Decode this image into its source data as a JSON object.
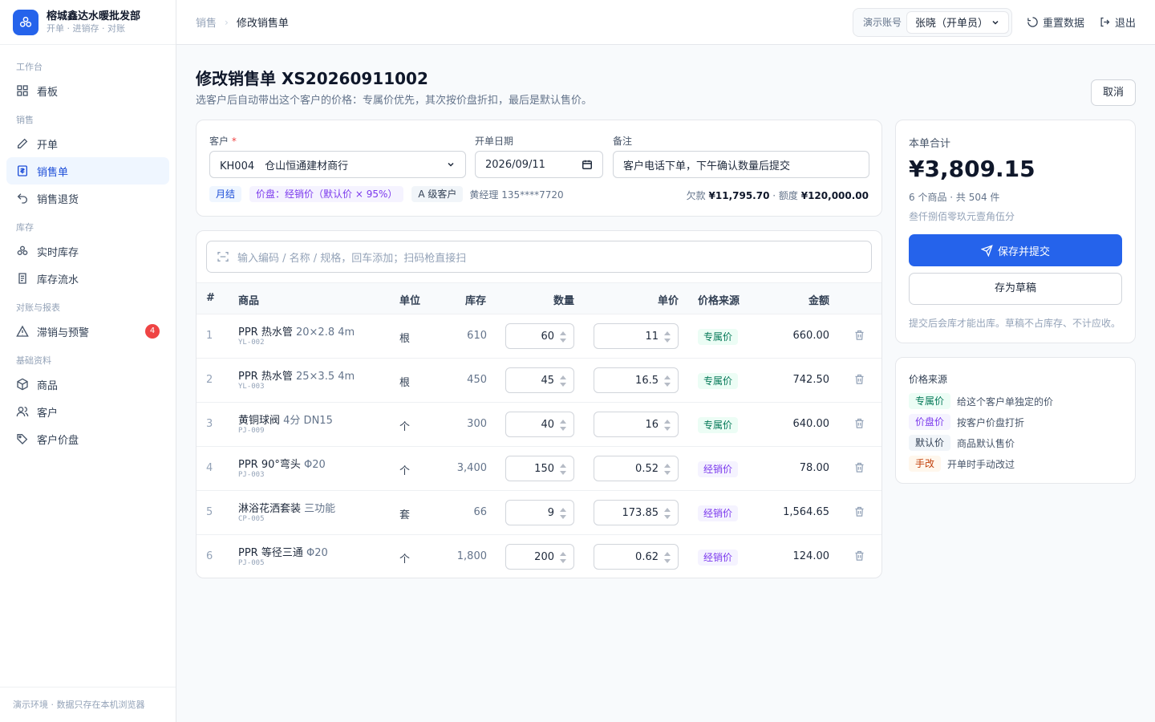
{
  "brand": {
    "name": "榕城鑫达水暖批发部",
    "sub": "开单 · 进销存 · 对账"
  },
  "nav": {
    "groups": [
      {
        "label": "工作台",
        "items": [
          {
            "label": "看板",
            "icon": "dashboard-icon"
          }
        ]
      },
      {
        "label": "销售",
        "items": [
          {
            "label": "开单",
            "icon": "edit-icon"
          },
          {
            "label": "销售单",
            "icon": "receipt-icon",
            "active": true
          },
          {
            "label": "销售退货",
            "icon": "undo-icon"
          }
        ]
      },
      {
        "label": "库存",
        "items": [
          {
            "label": "实时库存",
            "icon": "boxes-icon"
          },
          {
            "label": "库存流水",
            "icon": "scroll-icon"
          }
        ]
      },
      {
        "label": "对账与报表",
        "items": [
          {
            "label": "滞销与预警",
            "icon": "warning-icon",
            "badge": "4"
          }
        ]
      },
      {
        "label": "基础资料",
        "items": [
          {
            "label": "商品",
            "icon": "package-icon"
          },
          {
            "label": "客户",
            "icon": "users-icon"
          },
          {
            "label": "客户价盘",
            "icon": "tags-icon"
          }
        ]
      }
    ],
    "footer": "演示环境 · 数据只存在本机浏览器"
  },
  "topbar": {
    "crumb_parent": "销售",
    "crumb_current": "修改销售单",
    "account_label": "演示账号",
    "account_value": "张晓（开单员）",
    "reset_label": "重置数据",
    "logout_label": "退出"
  },
  "page": {
    "title": "修改销售单 XS20260911002",
    "subtitle": "选客户后自动带出这个客户的价格：专属价优先，其次按价盘折扣，最后是默认售价。",
    "cancel_label": "取消"
  },
  "form": {
    "customer_label": "客户",
    "customer_required": "*",
    "customer_value": "KH004　仓山恒通建材商行",
    "date_label": "开单日期",
    "date_value": "2026/09/11",
    "note_label": "备注",
    "note_value": "客户电话下单，下午确认数量后提交",
    "chip_billing": "月结",
    "chip_pricing": "价盘：经销价（默认价 × 95%）",
    "chip_level": "A 级客户",
    "manager": "黄经理 135****7720",
    "debt_prefix": "欠款",
    "debt_value": "¥11,795.70",
    "credit_prefix": "· 额度",
    "credit_value": "¥120,000.00"
  },
  "search": {
    "placeholder": "输入编码 / 名称 / 规格，回车添加；扫码枪直接扫"
  },
  "table": {
    "headers": {
      "idx": "#",
      "product": "商品",
      "unit": "单位",
      "stock": "库存",
      "qty": "数量",
      "price": "单价",
      "source": "价格来源",
      "amount": "金额"
    },
    "rows": [
      {
        "idx": "1",
        "name": "PPR 热水管",
        "spec": "20×2.8 4m",
        "code": "YL-002",
        "unit": "根",
        "stock": "610",
        "qty": "60",
        "price": "11",
        "source": "专属价",
        "source_type": "exclusive",
        "amount": "660.00"
      },
      {
        "idx": "2",
        "name": "PPR 热水管",
        "spec": "25×3.5 4m",
        "code": "YL-003",
        "unit": "根",
        "stock": "450",
        "qty": "45",
        "price": "16.5",
        "source": "专属价",
        "source_type": "exclusive",
        "amount": "742.50"
      },
      {
        "idx": "3",
        "name": "黄铜球阀",
        "spec": "4分 DN15",
        "code": "PJ-009",
        "unit": "个",
        "stock": "300",
        "qty": "40",
        "price": "16",
        "source": "专属价",
        "source_type": "exclusive",
        "amount": "640.00"
      },
      {
        "idx": "4",
        "name": "PPR 90°弯头",
        "spec": "Φ20",
        "code": "PJ-003",
        "unit": "个",
        "stock": "3,400",
        "qty": "150",
        "price": "0.52",
        "source": "经销价",
        "source_type": "dealer",
        "amount": "78.00"
      },
      {
        "idx": "5",
        "name": "淋浴花洒套装",
        "spec": "三功能",
        "code": "CP-005",
        "unit": "套",
        "stock": "66",
        "qty": "9",
        "price": "173.85",
        "source": "经销价",
        "source_type": "dealer",
        "amount": "1,564.65"
      },
      {
        "idx": "6",
        "name": "PPR 等径三通",
        "spec": "Φ20",
        "code": "PJ-005",
        "unit": "个",
        "stock": "1,800",
        "qty": "200",
        "price": "0.62",
        "source": "经销价",
        "source_type": "dealer",
        "amount": "124.00"
      }
    ]
  },
  "summary": {
    "label": "本单合计",
    "total": "¥3,809.15",
    "counts": "6 个商品 · 共 504 件",
    "in_words": "叁仟捌佰零玖元壹角伍分",
    "submit_label": "保存并提交",
    "draft_label": "存为草稿",
    "note": "提交后会库才能出库。草稿不占库存、不计应收。"
  },
  "legend": {
    "title": "价格来源",
    "items": [
      {
        "tag": "专属价",
        "desc": "给这个客户单独定的价",
        "type": "exclusive"
      },
      {
        "tag": "价盘价",
        "desc": "按客户价盘打折",
        "type": "dealer"
      },
      {
        "tag": "默认价",
        "desc": "商品默认售价",
        "type": "default"
      },
      {
        "tag": "手改",
        "desc": "开单时手动改过",
        "type": "manual"
      }
    ]
  },
  "colors": {
    "accent": "#2563eb",
    "exclusive": "#047857",
    "dealer": "#7c3aed",
    "manual": "#c2410c",
    "badge": "#ef4444"
  }
}
